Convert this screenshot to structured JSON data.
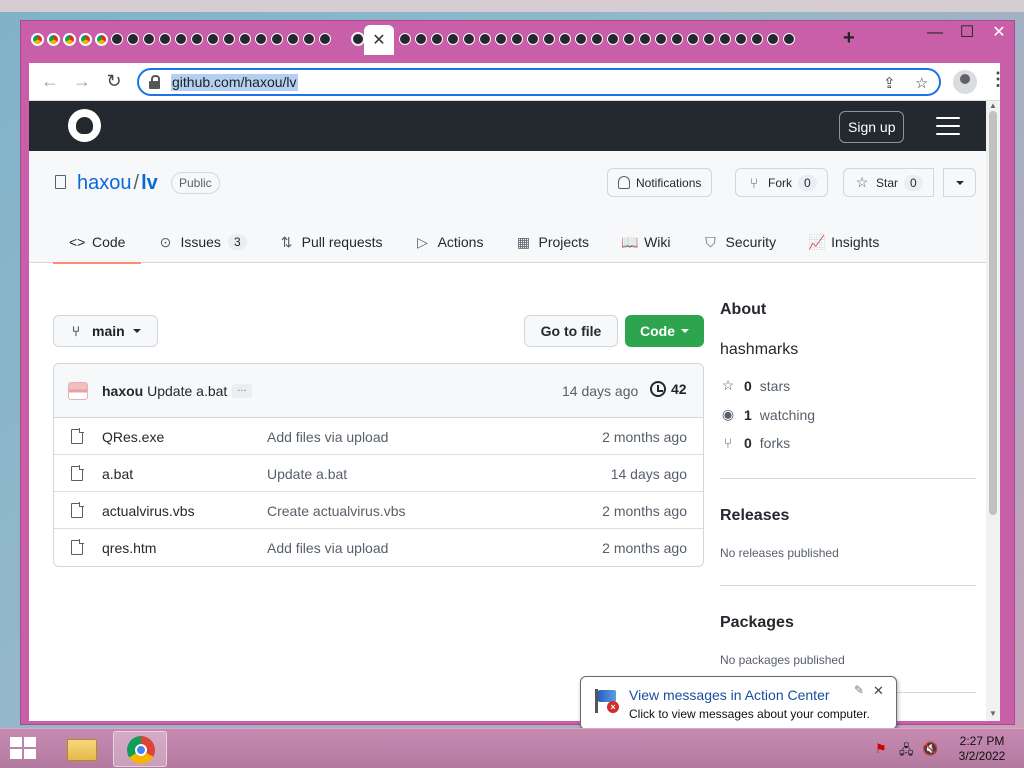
{
  "browser": {
    "url": "github.com/haxou/lv",
    "active_tab_close": "✕",
    "new_tab": "+",
    "window_controls": {
      "minimize": "—",
      "maximize": "☐",
      "close": "✕"
    }
  },
  "github": {
    "signup_label": "Sign up",
    "repo": {
      "owner": "haxou",
      "separator": "/",
      "name": "lv",
      "visibility": "Public"
    },
    "actions": {
      "notifications": "Notifications",
      "fork_label": "Fork",
      "fork_count": "0",
      "star_label": "Star",
      "star_count": "0"
    },
    "tabs": [
      {
        "label": "Code",
        "icon": "<>",
        "selected": true
      },
      {
        "label": "Issues",
        "icon": "⊙",
        "count": "3"
      },
      {
        "label": "Pull requests",
        "icon": "⇅"
      },
      {
        "label": "Actions",
        "icon": "▷"
      },
      {
        "label": "Projects",
        "icon": "▦"
      },
      {
        "label": "Wiki",
        "icon": "📖"
      },
      {
        "label": "Security",
        "icon": "⛉"
      },
      {
        "label": "Insights",
        "icon": "📈"
      }
    ],
    "branch": "main",
    "goto_file": "Go to file",
    "code_button": "Code",
    "latest_commit": {
      "author": "haxou",
      "message": "Update a.bat",
      "ellipsis": "…",
      "age": "14 days ago",
      "commit_count": "42"
    },
    "files": [
      {
        "name": "QRes.exe",
        "message": "Add files via upload",
        "age": "2 months ago"
      },
      {
        "name": "a.bat",
        "message": "Update a.bat",
        "age": "14 days ago"
      },
      {
        "name": "actualvirus.vbs",
        "message": "Create actualvirus.vbs",
        "age": "2 months ago"
      },
      {
        "name": "qres.htm",
        "message": "Add files via upload",
        "age": "2 months ago"
      }
    ],
    "about": {
      "heading": "About",
      "description": "hashmarks",
      "stars_count": "0",
      "stars_label": "stars",
      "watching_count": "1",
      "watching_label": "watching",
      "forks_count": "0",
      "forks_label": "forks"
    },
    "releases": {
      "heading": "Releases",
      "empty": "No releases published"
    },
    "packages": {
      "heading": "Packages",
      "empty": "No packages published"
    }
  },
  "notification": {
    "title": "View messages in Action Center",
    "subtitle": "Click to view messages about your computer.",
    "close": "✕"
  },
  "taskbar": {
    "time": "2:27 PM",
    "date": "3/2/2022"
  },
  "colors": {
    "window_frame": "#c85fa8",
    "github_header": "#24292f",
    "primary_green": "#2da44e",
    "link_blue": "#0969da",
    "tab_underline": "#fd8c73"
  }
}
